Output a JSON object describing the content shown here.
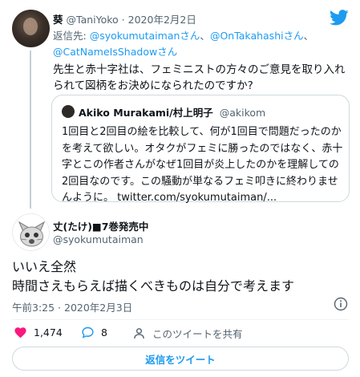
{
  "parent_tweet": {
    "name": "葵",
    "handle": "@TaniYoko",
    "separator": "·",
    "date": "2020年2月2日",
    "reply_prefix": "返信先: ",
    "mentions": [
      "@syokumutaimanさん",
      "@OnTakahashiさん",
      "@CatNameIsShadowさん"
    ],
    "mention_separator": "、",
    "text": "先生と赤十字社は、フェミニストの方々のご意見を取り入れられて図柄をお決めになられたのですか?"
  },
  "quoted_tweet": {
    "name": "Akiko Murakami/村上明子",
    "handle": "@akikom",
    "text": "1回目と2回目の絵を比較して、何が1回目で問題だったのかを考えて欲しい。オタクがフェミに勝ったのではなく、赤十字とこの作者さんがなぜ1回目が炎上したのかを理解しての2回目なのです。この騒動が単なるフェミ叩きに終わりませんように。",
    "link": "twitter.com/syokumutaiman/..."
  },
  "main_tweet": {
    "name": "丈(たけ)■7巻発売中",
    "handle": "@syokumutaiman",
    "text_line1": "いいえ全然",
    "text_line2": "時間さえもらえば描くべきものは自分で考えます",
    "timestamp": "午前3:25 · 2020年2月3日"
  },
  "actions": {
    "likes": "1,474",
    "replies": "8",
    "share_label": "このツイートを共有"
  },
  "reply_button_label": "返信をツイート",
  "colors": {
    "accent": "#1d9bf0",
    "like": "#f91880",
    "text": "#0f1419",
    "muted": "#536471",
    "border": "#cfd9de"
  },
  "icons": [
    "twitter-bird-icon",
    "info-icon",
    "heart-icon",
    "reply-bubble-icon",
    "profile-icon"
  ]
}
